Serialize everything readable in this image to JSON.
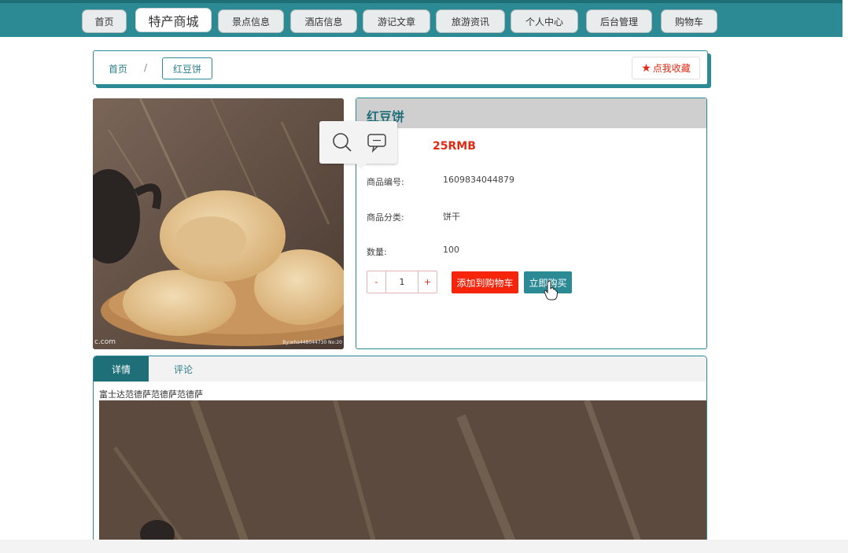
{
  "nav": {
    "items": [
      {
        "label": "首页"
      },
      {
        "label": "特产商城"
      },
      {
        "label": "景点信息"
      },
      {
        "label": "酒店信息"
      },
      {
        "label": "游记文章"
      },
      {
        "label": "旅游资讯"
      },
      {
        "label": "个人中心"
      },
      {
        "label": "后台管理"
      },
      {
        "label": "购物车"
      }
    ],
    "active_index": 1
  },
  "breadcrumb": {
    "home": "首页",
    "separator": "/",
    "current": "红豆饼"
  },
  "favorite": {
    "icon": "star-icon",
    "label": "点我收藏"
  },
  "image": {
    "watermark_left": "c.com",
    "watermark_right": "By:wha448044730 No:20"
  },
  "tools": {
    "icons": [
      "search-icon",
      "comment-icon"
    ]
  },
  "product": {
    "title": "红豆饼",
    "price": "25RMB",
    "fields": [
      {
        "label": "商品编号:",
        "value": "1609834044879"
      },
      {
        "label": "商品分类:",
        "value": "饼干"
      },
      {
        "label": "数量:",
        "value": "100"
      }
    ],
    "quantity": {
      "minus": "-",
      "value": "1",
      "plus": "+"
    },
    "add_to_cart": "添加到购物车",
    "buy_now": "立即购买"
  },
  "tabs": {
    "items": [
      {
        "label": "详情"
      },
      {
        "label": "评论"
      }
    ],
    "active_index": 0
  },
  "detail": {
    "text": "富士达范德萨范德萨范德萨"
  },
  "colors": {
    "primary": "#2c8a95",
    "primary_dark": "#1f6f78",
    "danger": "#f5240a",
    "price": "#e02a14"
  }
}
